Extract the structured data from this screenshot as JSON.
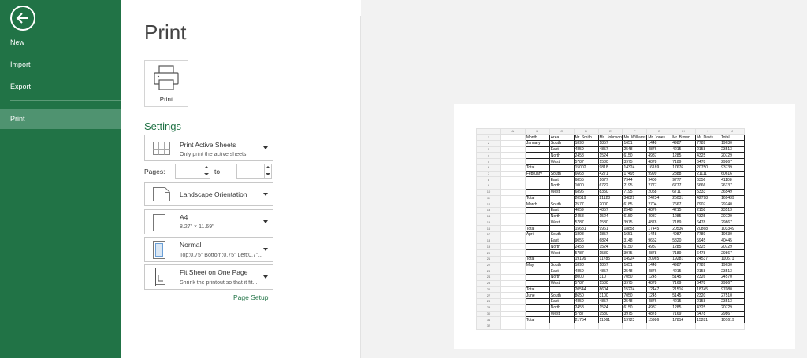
{
  "sidebar": {
    "back_icon": "arrow-left-icon",
    "items": [
      {
        "label": "New"
      },
      {
        "label": "Import"
      },
      {
        "label": "Export"
      },
      {
        "label": "Print"
      }
    ]
  },
  "main": {
    "title": "Print",
    "print_button_label": "Print",
    "settings_title": "Settings",
    "active_sheets": {
      "title": "Print Active Sheets",
      "subtitle": "Only print the active sheets"
    },
    "pages": {
      "label": "Pages:",
      "from": "",
      "to_label": "to",
      "to": ""
    },
    "orientation": {
      "title": "Landscape Orientation"
    },
    "paper": {
      "title": "A4",
      "subtitle": "8.27\" × 11.69\""
    },
    "margins": {
      "title": "Normal",
      "subtitle": "Top:0.75\" Bottom:0.75\" Left:0.7\"..."
    },
    "scaling": {
      "title": "Fit Sheet on One Page",
      "subtitle": "Shrink the printout so that it fit..."
    },
    "page_setup_link": "Page Setup"
  },
  "preview": {
    "col_headers": [
      "A",
      "B",
      "C",
      "D",
      "E",
      "F",
      "G",
      "H",
      "I",
      "J"
    ],
    "header_row": [
      "Month",
      "Area",
      "Mr. Smith",
      "Ms. Johnson",
      "Ms. Williams",
      "Mr. Jones",
      "Mr. Brown",
      "Mr. Davis",
      "Total"
    ],
    "rows": [
      [
        "January",
        "South",
        "1898",
        "1857",
        "1651",
        "1448",
        "4987",
        "7789",
        "19630"
      ],
      [
        "",
        "East",
        "4859",
        "4857",
        "2548",
        "4876",
        "4215",
        "2158",
        "23513"
      ],
      [
        "",
        "North",
        "2458",
        "1524",
        "6150",
        "4987",
        "1285",
        "4325",
        "20729"
      ],
      [
        "",
        "West",
        "5787",
        "1580",
        "3975",
        "4878",
        "7189",
        "6478",
        "29867"
      ],
      [
        "Total",
        "",
        "15002",
        "9818",
        "14324",
        "16189",
        "17676",
        "20750",
        "93739"
      ],
      [
        "February",
        "South",
        "6668",
        "4271",
        "17495",
        "9999",
        "2888",
        "21111",
        "60616"
      ],
      [
        "",
        "East",
        "6855",
        "1677",
        "7944",
        "9400",
        "9777",
        "6356",
        "41108"
      ],
      [
        "",
        "North",
        "1000",
        "6722",
        "2195",
        "2777",
        "6777",
        "6666",
        "26137"
      ],
      [
        "",
        "West",
        "6896",
        "8350",
        "7195",
        "2058",
        "6711",
        "5333",
        "36549"
      ],
      [
        "Total",
        "",
        "20519",
        "21128",
        "34829",
        "24234",
        "25031",
        "42798",
        "169439"
      ],
      [
        "March",
        "South",
        "2577",
        "2000",
        "6185",
        "2704",
        "7667",
        "7907",
        "29240"
      ],
      [
        "",
        "East",
        "4859",
        "4857",
        "2548",
        "4876",
        "4215",
        "2158",
        "23513"
      ],
      [
        "",
        "North",
        "2458",
        "1524",
        "6150",
        "4987",
        "1285",
        "4325",
        "20729"
      ],
      [
        "",
        "West",
        "5787",
        "1580",
        "3975",
        "4878",
        "7189",
        "6478",
        "29867"
      ],
      [
        "Total",
        "",
        "15681",
        "9961",
        "18858",
        "17445",
        "20536",
        "20868",
        "103349"
      ],
      [
        "April",
        "South",
        "1898",
        "1857",
        "1651",
        "1448",
        "4987",
        "7789",
        "19630"
      ],
      [
        "",
        "East",
        "9056",
        "6824",
        "3148",
        "9652",
        "5820",
        "5945",
        "40445"
      ],
      [
        "",
        "North",
        "2458",
        "1524",
        "6150",
        "4987",
        "1285",
        "4325",
        "20729"
      ],
      [
        "",
        "West",
        "5787",
        "1580",
        "3975",
        "4878",
        "7189",
        "6478",
        "29867"
      ],
      [
        "Total",
        "",
        "19199",
        "11785",
        "14924",
        "20965",
        "19281",
        "24537",
        "110671"
      ],
      [
        "May",
        "South",
        "1898",
        "1857",
        "1651",
        "1448",
        "4987",
        "7789",
        "19630"
      ],
      [
        "",
        "East",
        "4859",
        "4857",
        "2548",
        "4876",
        "4215",
        "2158",
        "23513"
      ],
      [
        "",
        "North",
        "8000",
        "310",
        "7050",
        "1245",
        "5145",
        "2326",
        "24570"
      ],
      [
        "",
        "West",
        "5787",
        "1580",
        "3975",
        "4878",
        "7169",
        "6478",
        "29867"
      ],
      [
        "Total",
        "",
        "20544",
        "8604",
        "15224",
        "12447",
        "21516",
        "18745",
        "97080"
      ],
      [
        "June",
        "South",
        "8650",
        "3100",
        "7050",
        "1245",
        "5145",
        "2320",
        "27510"
      ],
      [
        "",
        "East",
        "4859",
        "4857",
        "2548",
        "4876",
        "4215",
        "2158",
        "23513"
      ],
      [
        "",
        "North",
        "2458",
        "1524",
        "6150",
        "4987",
        "1285",
        "4325",
        "20729"
      ],
      [
        "",
        "West",
        "5787",
        "1580",
        "3975",
        "4878",
        "7169",
        "6478",
        "29867"
      ],
      [
        "Total",
        "",
        "21754",
        "11061",
        "19723",
        "15986",
        "17814",
        "15281",
        "101619"
      ]
    ]
  }
}
